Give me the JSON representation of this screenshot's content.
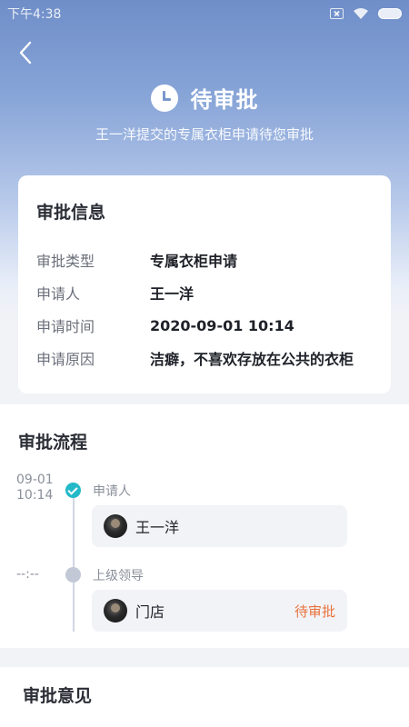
{
  "status_bar": {
    "time": "下午4:38"
  },
  "header": {
    "back_icon": "chevron-left-icon",
    "status_icon": "clock-icon",
    "title": "待审批",
    "subtitle": "王一洋提交的专属衣柜申请待您审批"
  },
  "info_card": {
    "title": "审批信息",
    "rows": [
      {
        "key": "审批类型",
        "value": "专属衣柜申请"
      },
      {
        "key": "申请人",
        "value": "王一洋"
      },
      {
        "key": "申请时间",
        "value": "2020-09-01 10:14"
      },
      {
        "key": "申请原因",
        "value": "洁癖，不喜欢存放在公共的衣柜"
      }
    ]
  },
  "flow": {
    "title": "审批流程",
    "steps": [
      {
        "time_line1": "09-01",
        "time_line2": "10:14",
        "role": "申请人",
        "name": "王一洋",
        "status": "",
        "done": true
      },
      {
        "time_line1": "--:--",
        "time_line2": "",
        "role": "上级领导",
        "name": "门店",
        "status": "待审批",
        "done": false
      }
    ]
  },
  "opinion": {
    "title": "审批意见"
  },
  "colors": {
    "accent_done": "#22b9c8",
    "pending_status": "#e8723c",
    "header_gradient_top": "#6f8ec8"
  }
}
